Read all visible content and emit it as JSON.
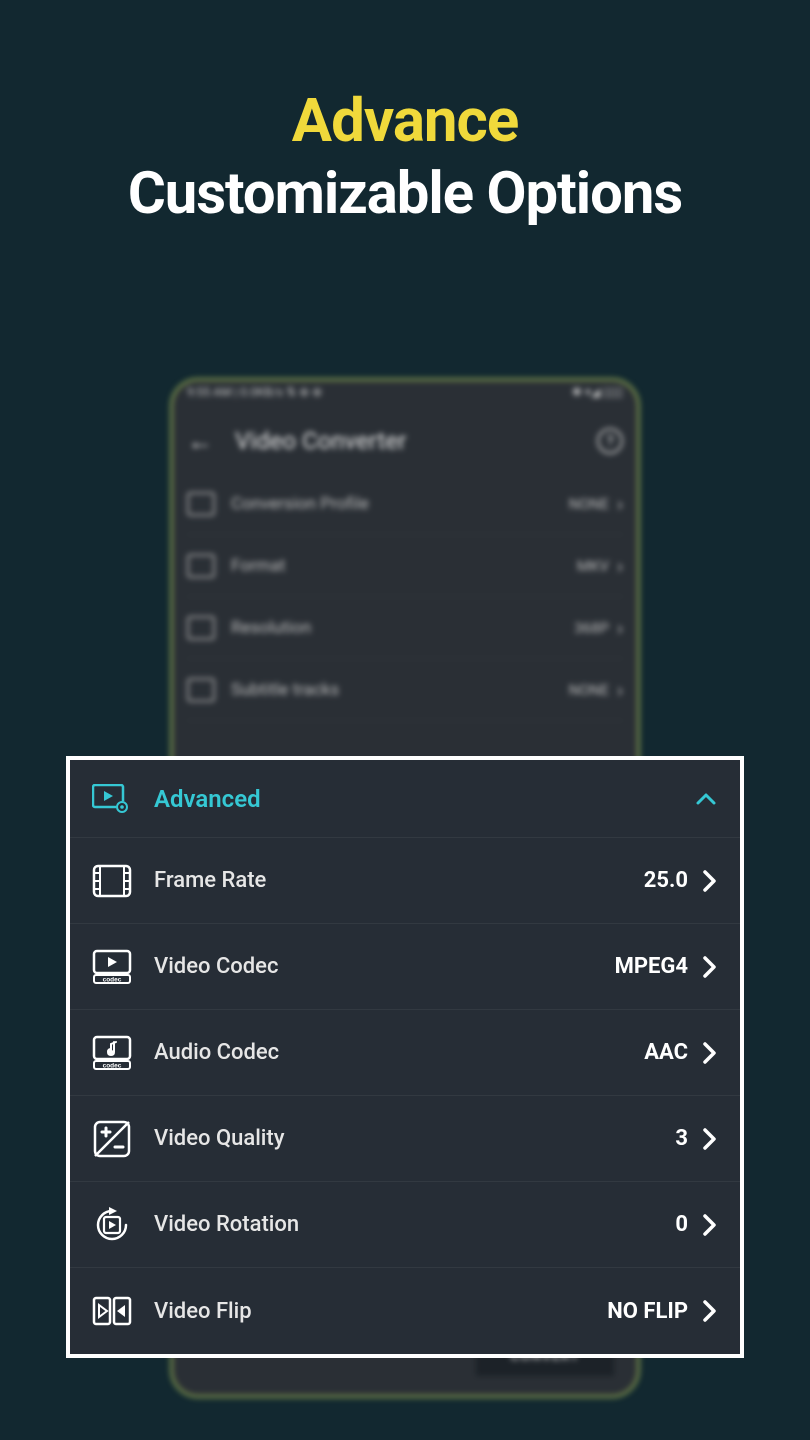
{
  "promo": {
    "line1": "Advance",
    "line2": "Customizable Options"
  },
  "phone": {
    "status_left": "9:55 AM | 0.0KB/s ⇅ ⊕ ⊕",
    "status_right": "✱ ▾◢ ▯▯▯",
    "title": "Video Converter",
    "help_glyph": "?",
    "convert_label": "CONVERT",
    "basic_rows": [
      {
        "label": "Conversion Profile",
        "value": "NONE"
      },
      {
        "label": "Format",
        "value": "MKV"
      },
      {
        "label": "Resolution",
        "value": "368P"
      },
      {
        "label": "Subtitle tracks",
        "value": "NONE"
      }
    ]
  },
  "advanced": {
    "title": "Advanced",
    "rows": [
      {
        "icon": "film-icon",
        "label": "Frame Rate",
        "value": "25.0"
      },
      {
        "icon": "video-codec-icon",
        "label": "Video Codec",
        "value": "MPEG4"
      },
      {
        "icon": "audio-codec-icon",
        "label": "Audio Codec",
        "value": "AAC"
      },
      {
        "icon": "video-quality-icon",
        "label": "Video Quality",
        "value": "3"
      },
      {
        "icon": "video-rotation-icon",
        "label": "Video Rotation",
        "value": "0"
      },
      {
        "icon": "video-flip-icon",
        "label": "Video Flip",
        "value": "NO FLIP"
      }
    ]
  }
}
